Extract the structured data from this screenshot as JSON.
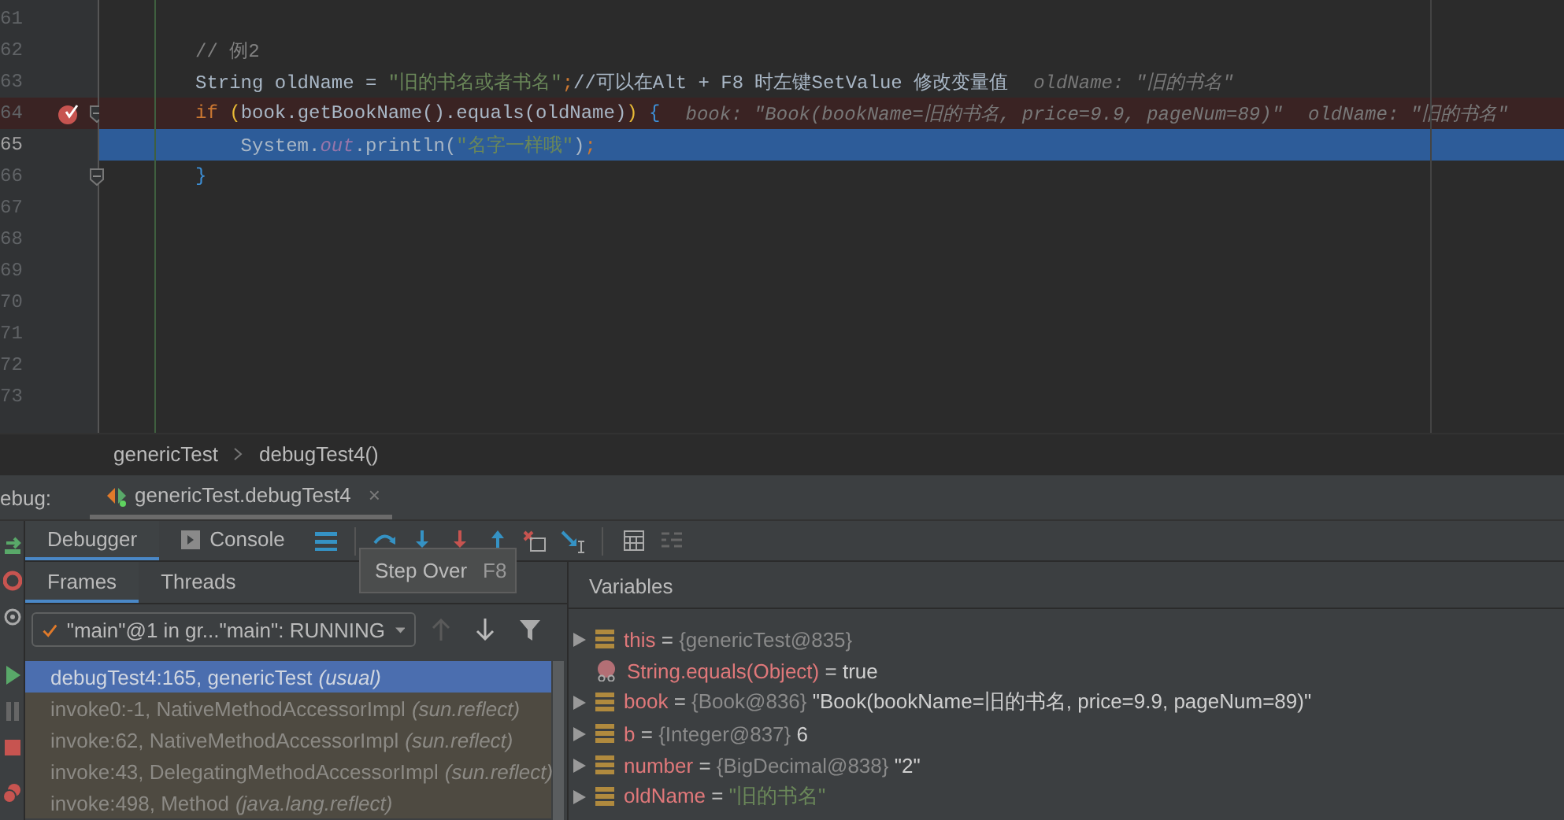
{
  "editor": {
    "lines": [
      {
        "number": "61",
        "breakpoint": false,
        "current": false,
        "fold": false
      },
      {
        "number": "62",
        "tokens": [
          {
            "kind": "comment",
            "text": "// 例2"
          }
        ],
        "breakpoint": false,
        "current": false,
        "fold": false
      },
      {
        "number": "63",
        "tokens": [
          {
            "kind": "plain",
            "text": "String oldName = "
          },
          {
            "kind": "string",
            "text": "\"旧的书名或者书名\""
          },
          {
            "kind": "keyword",
            "text": ";"
          },
          {
            "kind": "plain",
            "text": "//可以在Alt + F8 时左键SetValue 修改变量值"
          }
        ],
        "breakpoint": false,
        "current": false,
        "fold": false,
        "hints": [
          "oldName: \"旧的书名\""
        ]
      },
      {
        "number": "64",
        "tokens": [
          {
            "kind": "keyword",
            "text": "if "
          },
          {
            "kind": "paren",
            "text": "("
          },
          {
            "kind": "plain",
            "text": "book.getBookName().equals(oldName)"
          },
          {
            "kind": "paren",
            "text": ")"
          },
          {
            "kind": "brace",
            "text": " {"
          }
        ],
        "breakpoint": true,
        "current": false,
        "fold": true,
        "hints": [
          "book: \"Book(bookName=旧的书名, price=9.9, pageNum=89)\"",
          "oldName: \"旧的书名\""
        ]
      },
      {
        "number": "65",
        "tokens": [
          {
            "kind": "plain",
            "text": "    System."
          },
          {
            "kind": "field",
            "text": "out"
          },
          {
            "kind": "plain",
            "text": ".println("
          },
          {
            "kind": "string",
            "text": "\"名字一样哦\""
          },
          {
            "kind": "plain",
            "text": ")"
          },
          {
            "kind": "keyword",
            "text": ";"
          }
        ],
        "breakpoint": false,
        "current": true,
        "fold": false
      },
      {
        "number": "66",
        "tokens": [
          {
            "kind": "brace",
            "text": "}"
          }
        ],
        "breakpoint": false,
        "current": false,
        "fold": true
      },
      {
        "number": "67",
        "breakpoint": false,
        "current": false,
        "fold": false
      },
      {
        "number": "68",
        "breakpoint": false,
        "current": false,
        "fold": false
      },
      {
        "number": "69",
        "breakpoint": false,
        "current": false,
        "fold": false
      },
      {
        "number": "70",
        "breakpoint": false,
        "current": false,
        "fold": false
      },
      {
        "number": "71",
        "breakpoint": false,
        "current": false,
        "fold": false
      },
      {
        "number": "72",
        "breakpoint": false,
        "current": false,
        "fold": false
      },
      {
        "number": "73",
        "breakpoint": false,
        "current": false,
        "fold": false
      }
    ]
  },
  "breadcrumb": [
    "genericTest",
    "debugTest4()"
  ],
  "debug_bar": {
    "label": "ebug:",
    "session": "genericTest.debugTest4",
    "close": "×"
  },
  "panel_tabs": [
    {
      "label": "Debugger",
      "selected": true
    },
    {
      "label": "Console",
      "selected": false
    }
  ],
  "tooltip": {
    "text": "Step Over",
    "shortcut": "F8"
  },
  "frame_tabs": [
    {
      "label": "Frames",
      "selected": true
    },
    {
      "label": "Threads",
      "selected": false
    }
  ],
  "thread_select": {
    "value": "\"main\"@1 in gr...\"main\": RUNNING"
  },
  "frames": [
    {
      "text": "debugTest4:165, genericTest",
      "package": "(usual)",
      "selected": true,
      "library": false
    },
    {
      "text": "invoke0:-1, NativeMethodAccessorImpl",
      "package": "(sun.reflect)",
      "selected": false,
      "library": true
    },
    {
      "text": "invoke:62, NativeMethodAccessorImpl",
      "package": "(sun.reflect)",
      "selected": false,
      "library": true
    },
    {
      "text": "invoke:43, DelegatingMethodAccessorImpl",
      "package": "(sun.reflect)",
      "selected": false,
      "library": true
    },
    {
      "text": "invoke:498, Method",
      "package": "(java.lang.reflect)",
      "selected": false,
      "library": true
    }
  ],
  "variables": {
    "title": "Variables",
    "items": [
      {
        "kind": "field",
        "expandable": true,
        "name": "this",
        "separator": "=",
        "ref": "{genericTest@835}"
      },
      {
        "kind": "method",
        "expandable": false,
        "name": "String.equals(Object)",
        "separator": "=",
        "value": "true",
        "string_value": false
      },
      {
        "kind": "field",
        "expandable": true,
        "name": "book",
        "separator": "=",
        "ref": "{Book@836}",
        "value": "\"Book(bookName=旧的书名, price=9.9, pageNum=89)\"",
        "string_value": false
      },
      {
        "kind": "field",
        "expandable": true,
        "name": "b",
        "separator": "=",
        "ref": "{Integer@837}",
        "value": "6",
        "string_value": false
      },
      {
        "kind": "field",
        "expandable": true,
        "name": "number",
        "separator": "=",
        "ref": "{BigDecimal@838}",
        "value": "\"2\"",
        "string_value": false
      },
      {
        "kind": "field",
        "expandable": true,
        "name": "oldName",
        "separator": "=",
        "value": "\"旧的书名\"",
        "string_value": true
      }
    ]
  }
}
